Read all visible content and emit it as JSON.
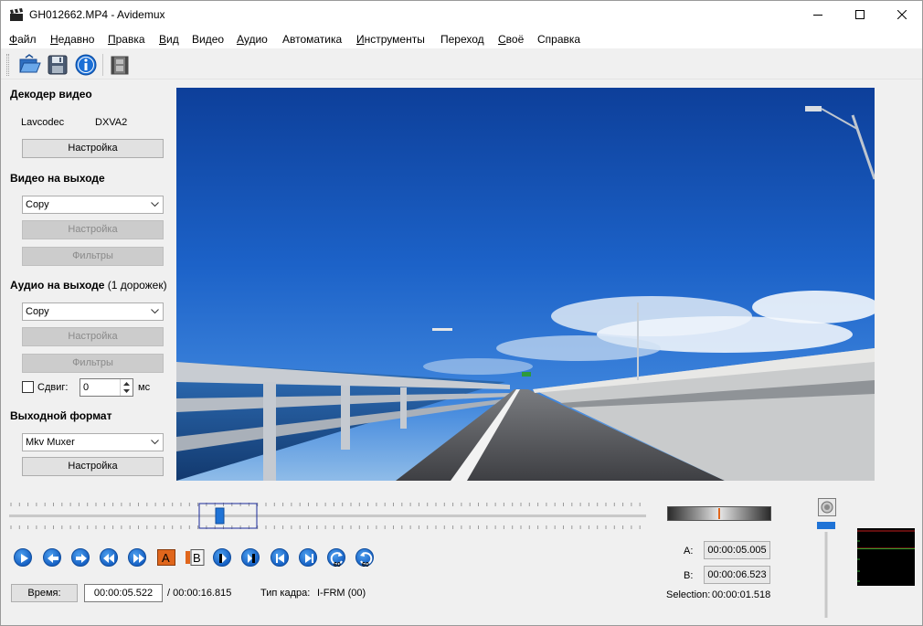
{
  "window": {
    "title": "GH012662.MP4 - Avidemux",
    "controls": [
      "minimize",
      "maximize",
      "close"
    ]
  },
  "menu": [
    {
      "label": "Файл",
      "underline": "Ф",
      "rest": "айл"
    },
    {
      "label": "Недавно",
      "underline": "Н",
      "rest": "едавно"
    },
    {
      "label": "Правка",
      "underline": "П",
      "rest": "равка"
    },
    {
      "label": "Вид",
      "underline": "В",
      "rest": "ид"
    },
    {
      "label": "Видео",
      "underline": "",
      "rest": "Видео"
    },
    {
      "label": "Аудио",
      "underline": "А",
      "rest": "удио"
    },
    {
      "label": "Автоматика",
      "underline": "",
      "rest": "Автоматика"
    },
    {
      "label": "Инструменты",
      "underline": "И",
      "rest": "нструменты"
    },
    {
      "label": "Переход",
      "underline": "",
      "rest": "Переход"
    },
    {
      "label": "Своё",
      "underline": "С",
      "rest": "воё"
    },
    {
      "label": "Справка",
      "underline": "",
      "rest": "Справка"
    }
  ],
  "toolbar": {
    "icons": [
      "open-icon",
      "save-icon",
      "info-icon",
      "film-calculator-icon"
    ]
  },
  "decoder": {
    "title": "Декодер видео",
    "codec": "Lavcodec",
    "hw": "DXVA2",
    "settings_label": "Настройка"
  },
  "video_out": {
    "title": "Видео на выходе",
    "codec": "Copy",
    "settings_label": "Настройка",
    "filters_label": "Фильтры"
  },
  "audio_out": {
    "title": "Аудио на выходе",
    "tracks": "(1 дорожек)",
    "codec": "Copy",
    "settings_label": "Настройка",
    "filters_label": "Фильтры",
    "shift_label": "Сдвиг:",
    "shift_value": "0",
    "shift_unit": "мс"
  },
  "format": {
    "title": "Выходной формат",
    "muxer": "Mkv Muxer",
    "settings_label": "Настройка"
  },
  "playback": {
    "time_button": "Время:",
    "current_time": "00:00:05.522",
    "total_time": "/ 00:00:16.815",
    "frame_type_label": "Тип кадра:",
    "frame_type": "I-FRM (00)",
    "position": 0.33
  },
  "markers": {
    "a_label": "A:",
    "a_value": "00:00:05.005",
    "b_label": "B:",
    "b_value": "00:00:06.523",
    "selection_label": "Selection:",
    "selection_value": "00:00:01.518"
  },
  "colors": {
    "accent": "#1f73d6",
    "sky": "#1b5fc7",
    "marker_a": "#e0661c"
  }
}
